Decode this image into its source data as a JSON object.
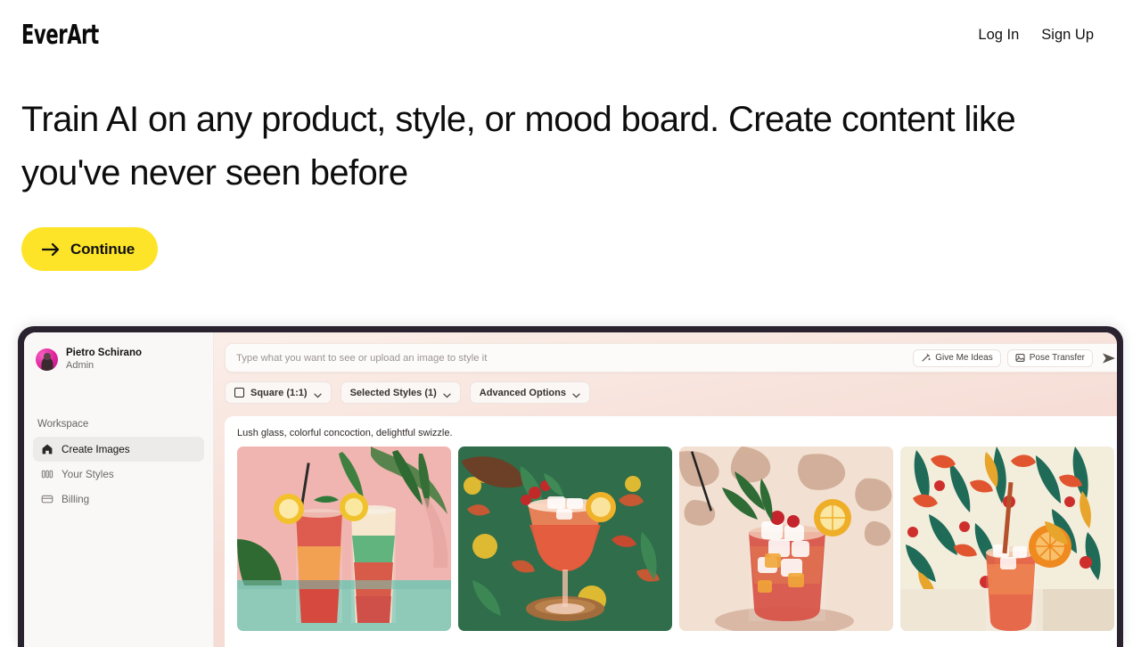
{
  "brand": {
    "logo": "EverArt"
  },
  "nav": {
    "login": "Log In",
    "signup": "Sign Up"
  },
  "hero": {
    "title": "Train AI on any product, style, or mood board. Create content like you've never seen before",
    "cta_label": "Continue",
    "cta_color": "#FDE428"
  },
  "app": {
    "sidebar": {
      "user_name": "Pietro Schirano",
      "user_role": "Admin",
      "section_label": "Workspace",
      "items": [
        {
          "label": "Create Images",
          "icon": "home-icon",
          "active": true
        },
        {
          "label": "Your Styles",
          "icon": "bars-icon",
          "active": false
        },
        {
          "label": "Billing",
          "icon": "credit-card-icon",
          "active": false
        }
      ]
    },
    "prompt": {
      "placeholder": "Type what you want to see or upload an image to style it",
      "ideas_label": "Give Me Ideas",
      "pose_label": "Pose Transfer",
      "send_icon": "send-icon"
    },
    "toolbar": [
      {
        "label": "Square (1:1)",
        "icon": "square-icon"
      },
      {
        "label": "Selected Styles (1)",
        "icon": ""
      },
      {
        "label": "Advanced Options",
        "icon": ""
      }
    ],
    "results": {
      "caption": "Lush glass, colorful concoction, delightful swizzle.",
      "images": [
        {
          "alt": "Two layered tropical cocktails on mint table with pink wall and palm leaves"
        },
        {
          "alt": "Stemmed coupe cocktail on green floral tablecloth with lemons"
        },
        {
          "alt": "Red cocktail in rocks glass with mint and lemon wheel, dappled shadows"
        },
        {
          "alt": "Cocktail with orange slice against tropical floral wallpaper"
        }
      ]
    }
  }
}
